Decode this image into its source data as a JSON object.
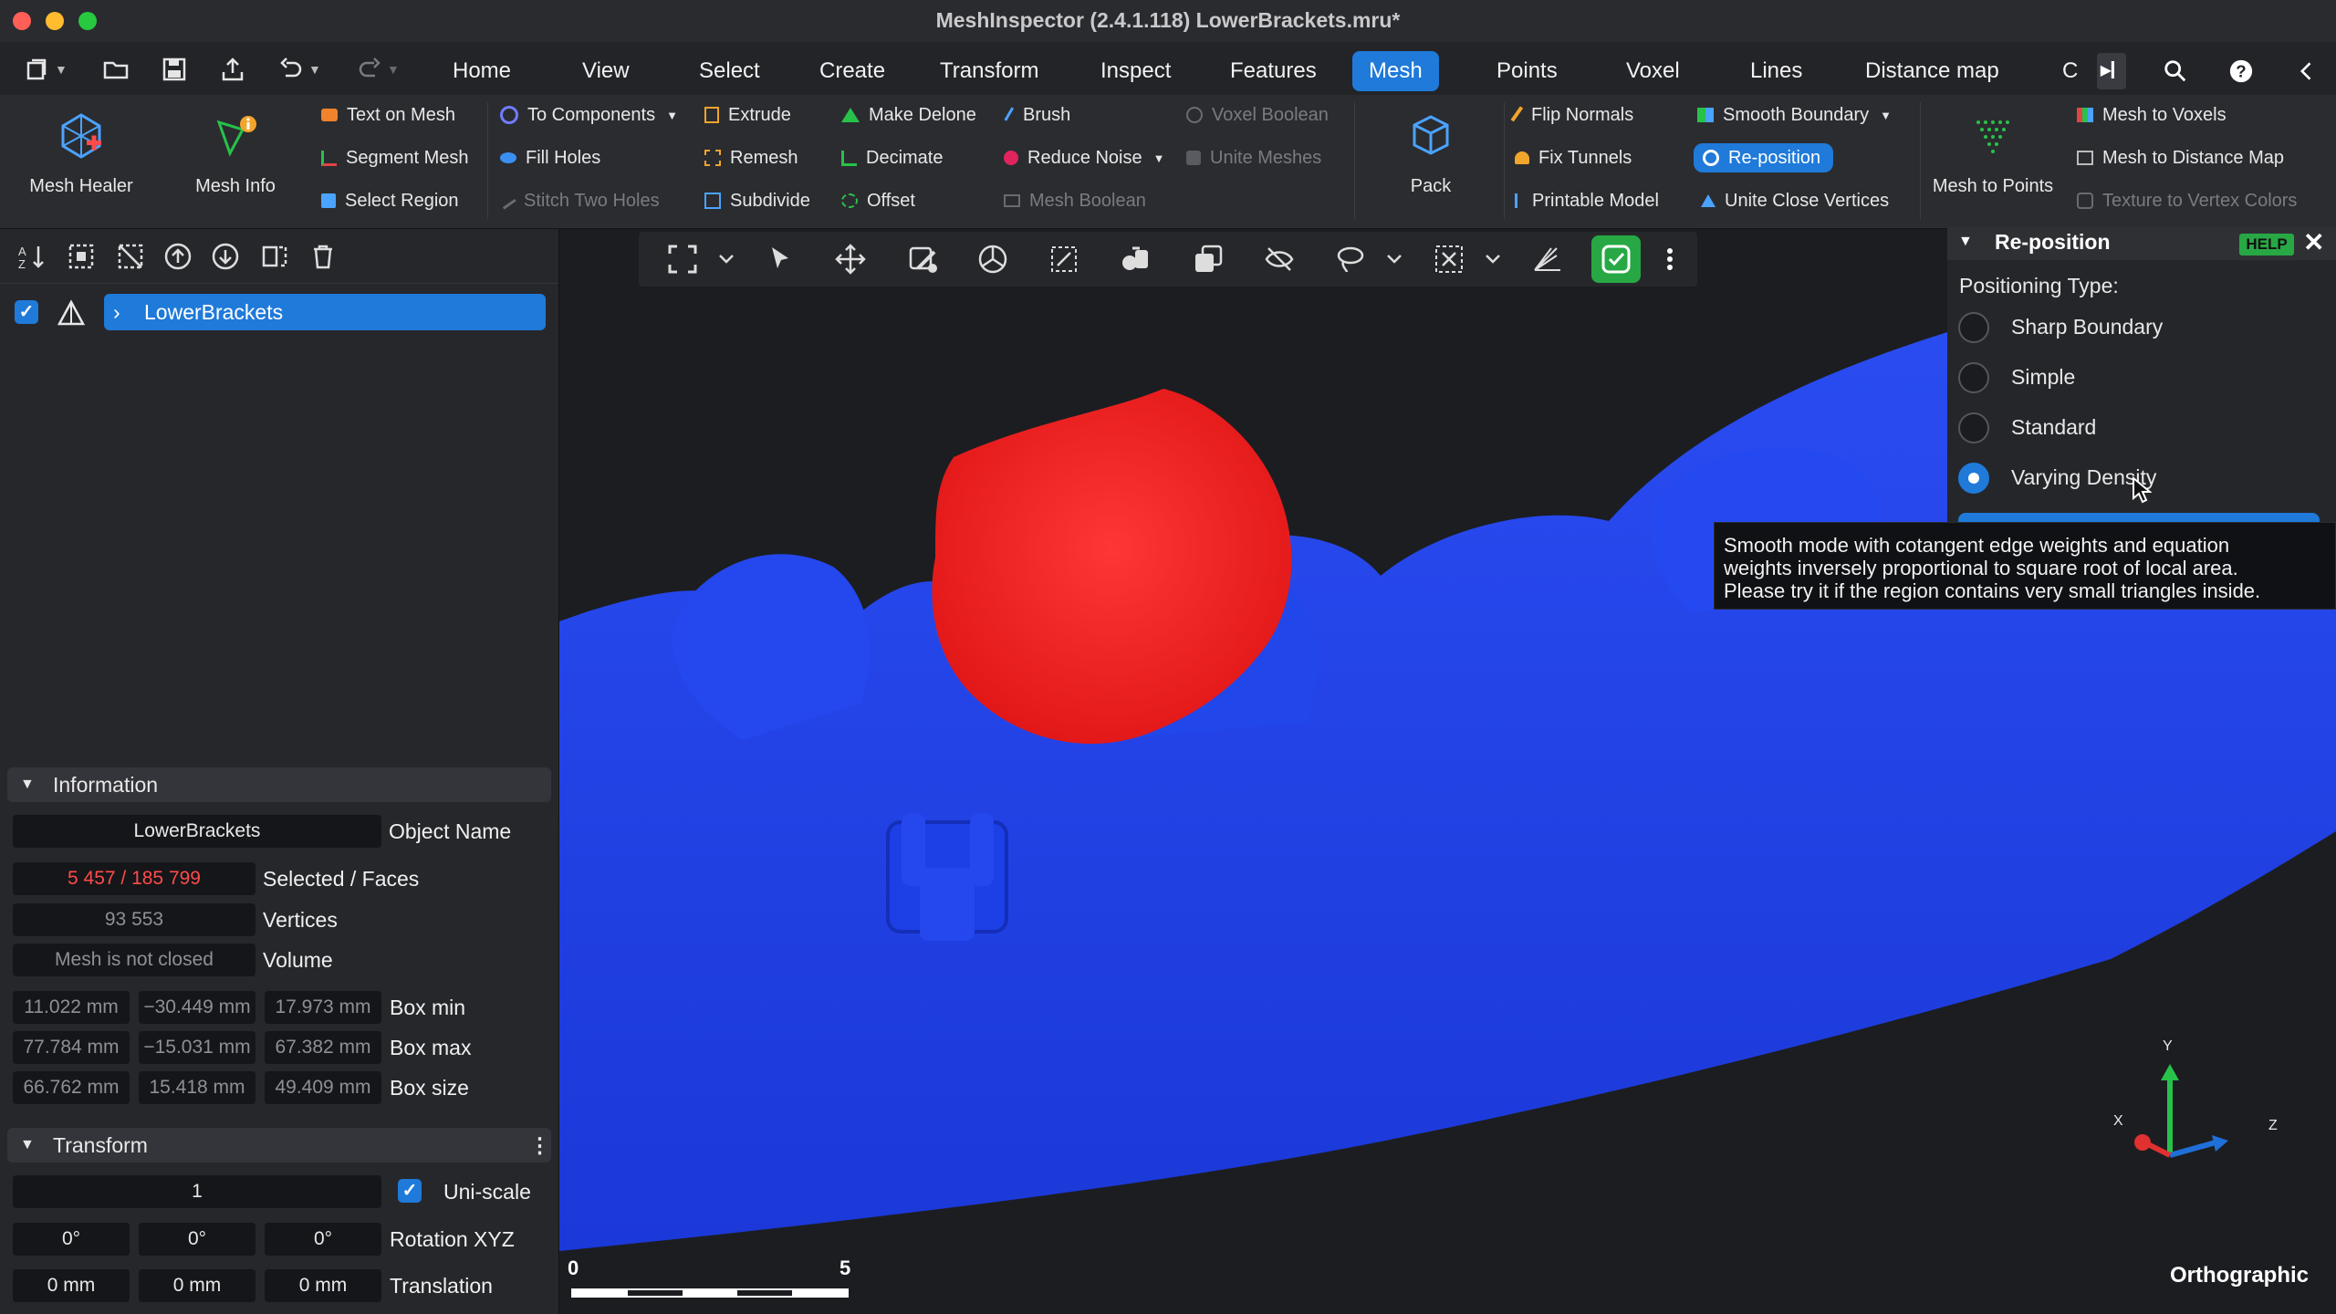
{
  "window": {
    "title": "MeshInspector (2.4.1.118) LowerBrackets.mru*",
    "traffic_colors": [
      "#ff5f57",
      "#febc2e",
      "#28c840"
    ]
  },
  "menu": {
    "tabs": [
      "Home",
      "View",
      "Select",
      "Create",
      "Transform",
      "Inspect",
      "Features",
      "Mesh",
      "Points",
      "Voxel",
      "Lines",
      "Distance map",
      "C"
    ],
    "active": "Mesh"
  },
  "ribbon": {
    "mesh_healer": "Mesh Healer",
    "mesh_info": "Mesh Info",
    "text_on_mesh": "Text on Mesh",
    "segment_mesh": "Segment Mesh",
    "select_region": "Select Region",
    "to_components": "To Components",
    "fill_holes": "Fill Holes",
    "stitch_two_holes": "Stitch Two Holes",
    "extrude": "Extrude",
    "remesh": "Remesh",
    "subdivide": "Subdivide",
    "make_delone": "Make Delone",
    "decimate": "Decimate",
    "offset": "Offset",
    "brush": "Brush",
    "reduce_noise": "Reduce Noise",
    "mesh_boolean": "Mesh Boolean",
    "voxel_boolean": "Voxel Boolean",
    "unite_meshes": "Unite Meshes",
    "pack": "Pack",
    "flip_normals": "Flip Normals",
    "fix_tunnels": "Fix Tunnels",
    "printable_model": "Printable Model",
    "smooth_boundary": "Smooth Boundary",
    "re_position": "Re-position",
    "unite_close_vertices": "Unite Close Vertices",
    "mesh_to_points": "Mesh to Points",
    "mesh_to_voxels": "Mesh to Voxels",
    "mesh_to_distance_map": "Mesh to Distance Map",
    "texture_to_vertex_colors": "Texture to Vertex Colors"
  },
  "scene_tree": {
    "object": "LowerBrackets",
    "checked": true
  },
  "information": {
    "header": "Information",
    "object_name_value": "LowerBrackets",
    "object_name_label": "Object Name",
    "selected_faces_value": "5 457 / 185 799",
    "selected_faces_label": "Selected / Faces",
    "vertices_value": "93 553",
    "vertices_label": "Vertices",
    "volume_value": "Mesh is not closed",
    "volume_label": "Volume",
    "box_min": [
      "11.022 mm",
      "−30.449 mm",
      "17.973 mm"
    ],
    "box_min_label": "Box min",
    "box_max": [
      "77.784 mm",
      "−15.031 mm",
      "67.382 mm"
    ],
    "box_max_label": "Box max",
    "box_size": [
      "66.762 mm",
      "15.418 mm",
      "49.409 mm"
    ],
    "box_size_label": "Box size"
  },
  "transform": {
    "header": "Transform",
    "scale_value": "1",
    "uniscale_label": "Uni-scale",
    "uniscale_checked": true,
    "rotation": [
      "0°",
      "0°",
      "0°"
    ],
    "rotation_label": "Rotation XYZ",
    "translation": [
      "0 mm",
      "0 mm",
      "0 mm"
    ],
    "translation_label": "Translation"
  },
  "reposition_panel": {
    "title": "Re-position",
    "help": "HELP",
    "positioning_type_label": "Positioning Type:",
    "options": [
      "Sharp Boundary",
      "Simple",
      "Standard",
      "Varying Density"
    ],
    "selected": "Varying Density",
    "tooltip": [
      "Smooth mode with cotangent edge weights and equation",
      "weights inversely proportional to square root of local area.",
      "Please try it if the region contains very small triangles inside."
    ]
  },
  "viewport": {
    "projection": "Orthographic",
    "scale_start": "0",
    "scale_end": "5",
    "axis_labels": {
      "x": "X",
      "y": "Y",
      "z": "Z"
    },
    "mesh_color": "#1d3fe6",
    "selection_color": "#ee1a1a"
  }
}
